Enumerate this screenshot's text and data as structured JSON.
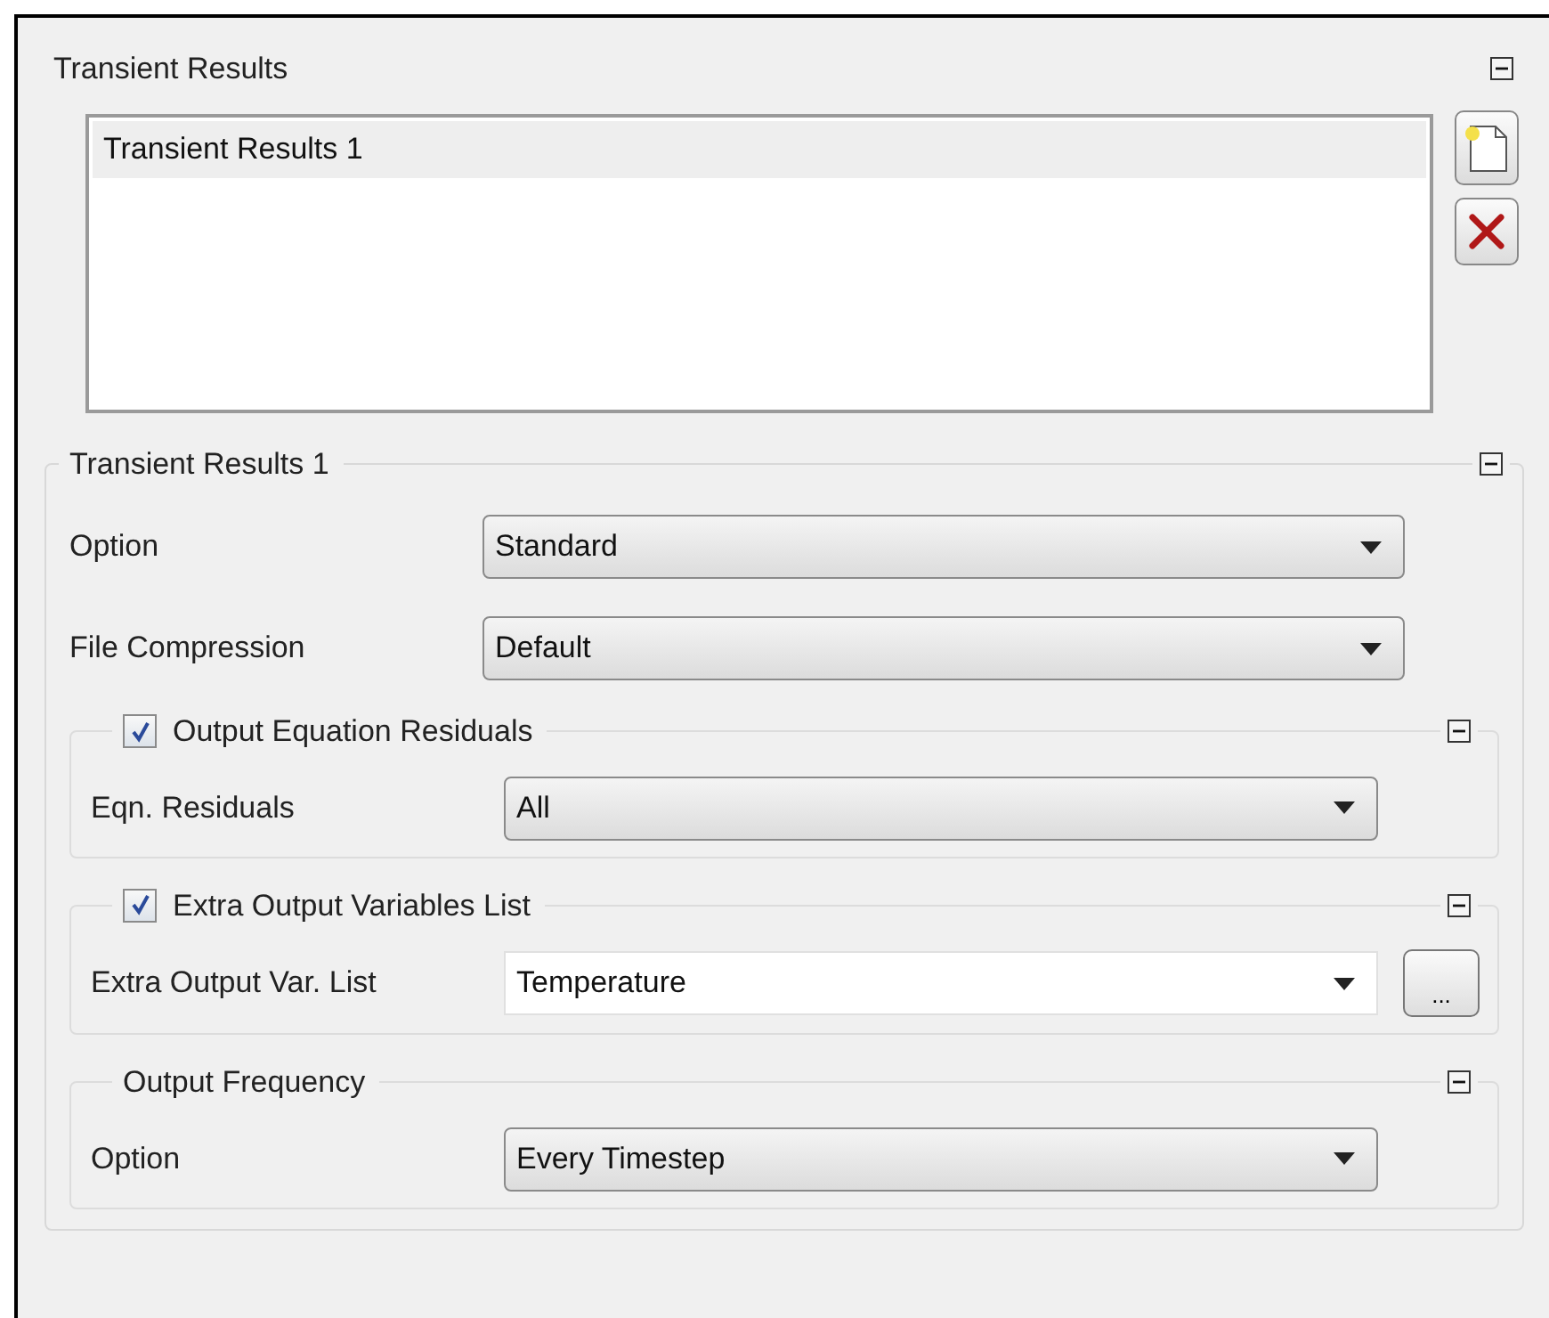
{
  "panel": {
    "title": "Transient Results",
    "expanded": true,
    "list": [
      {
        "label": "Transient Results 1",
        "selected": true
      }
    ],
    "details": {
      "title": "Transient Results 1",
      "expanded": true,
      "fields": [
        {
          "label": "Option",
          "value": "Standard"
        },
        {
          "label": "File Compression",
          "value": "Default"
        }
      ],
      "groups": [
        {
          "kind": "checkable",
          "title": "Output Equation Residuals",
          "checked": true,
          "expanded": true,
          "field": {
            "label": "Eqn. Residuals",
            "value": "All",
            "editable": false
          }
        },
        {
          "kind": "checkable",
          "title": "Extra Output Variables List",
          "checked": true,
          "expanded": true,
          "field": {
            "label": "Extra Output Var. List",
            "value": "Temperature",
            "editable": true,
            "browse_label": "..."
          }
        },
        {
          "kind": "plain",
          "title": "Output Frequency",
          "expanded": true,
          "field": {
            "label": "Option",
            "value": "Every Timestep",
            "editable": false
          }
        }
      ]
    }
  }
}
